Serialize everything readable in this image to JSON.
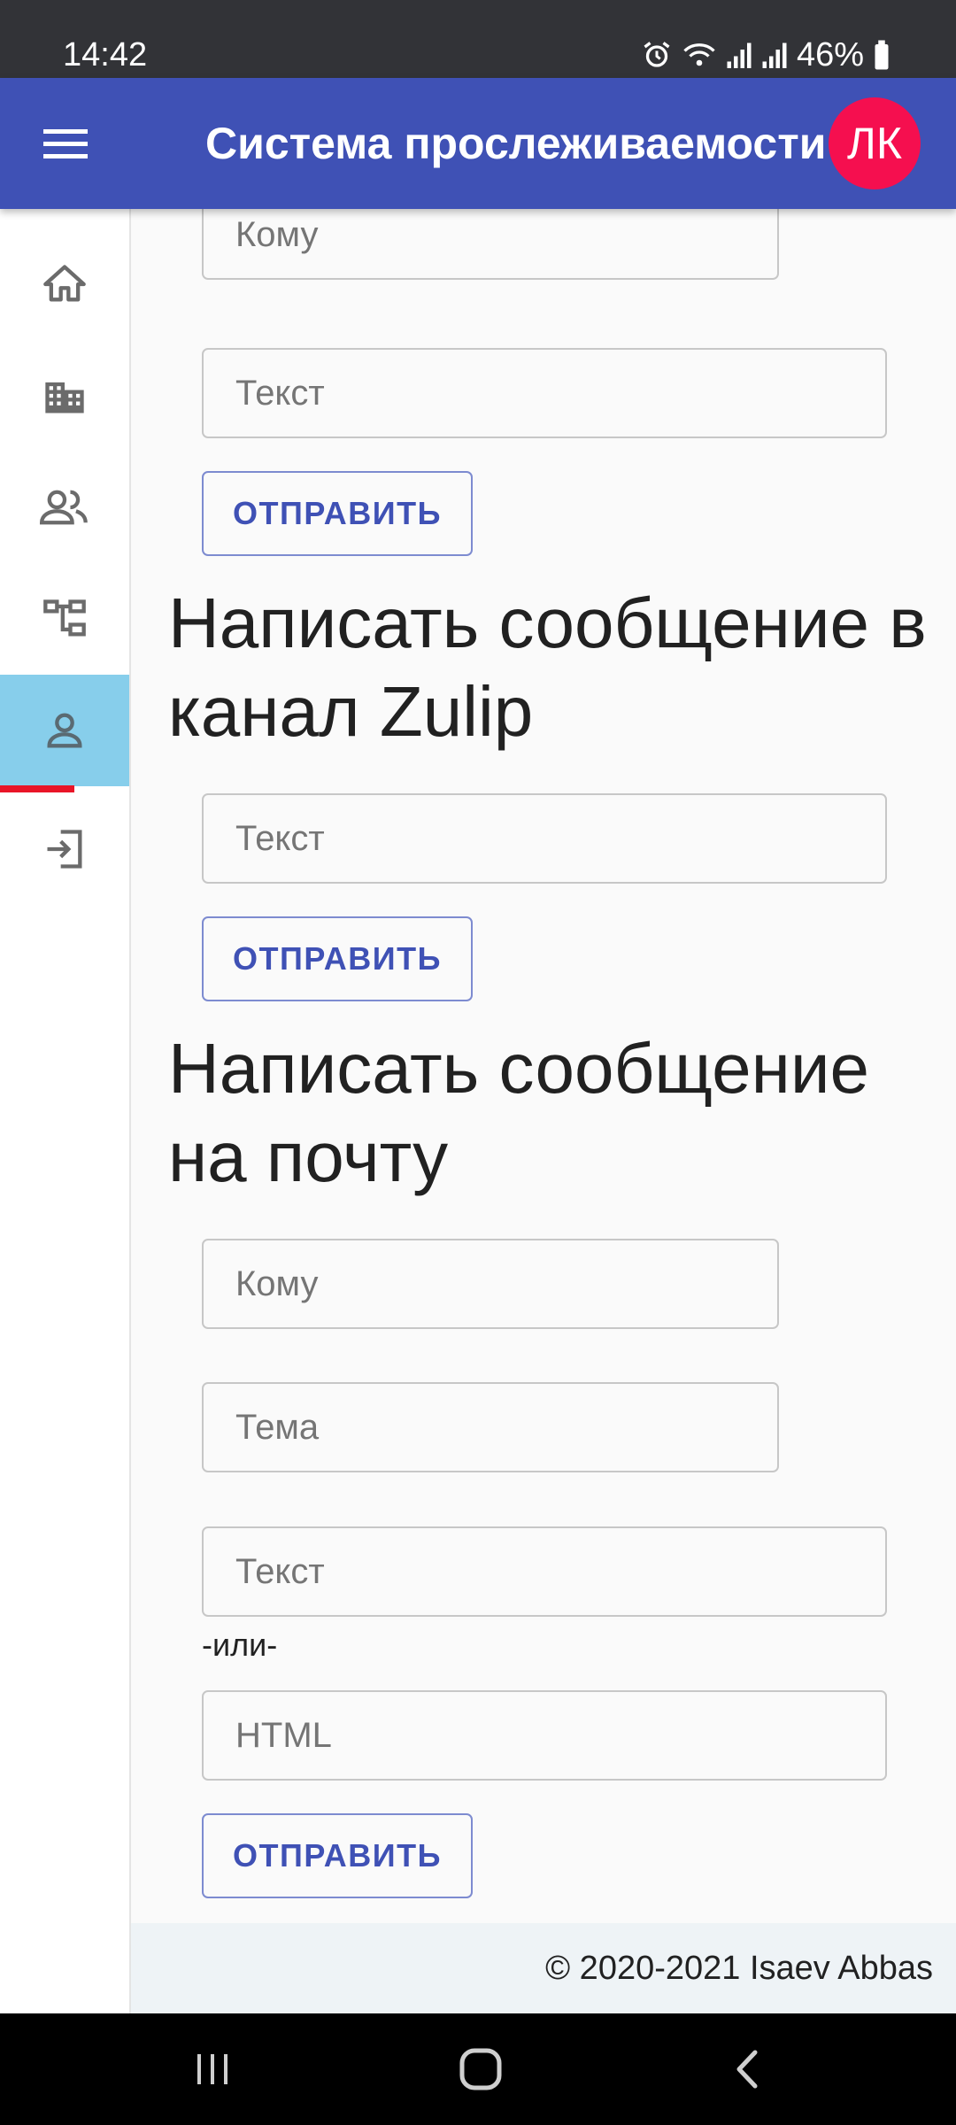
{
  "status_bar": {
    "time": "14:42",
    "battery": "46%",
    "icons": [
      "alarm-icon",
      "wifi-icon",
      "signal-icon",
      "signal-icon",
      "battery-icon"
    ]
  },
  "app_bar": {
    "title": "Система прослеживаемости",
    "profile_label": "ЛК",
    "color": "#3f51b5",
    "profile_color": "#f50f4f"
  },
  "sidebar": {
    "items": [
      {
        "icon": "home-icon",
        "active": false
      },
      {
        "icon": "building-icon",
        "active": false
      },
      {
        "icon": "people-icon",
        "active": false
      },
      {
        "icon": "hierarchy-icon",
        "active": false
      },
      {
        "icon": "person-icon",
        "active": true
      },
      {
        "icon": "logout-icon",
        "active": false
      }
    ],
    "active_color": "#87ceeb",
    "indicator_color": "#e91528"
  },
  "form_top": {
    "to_placeholder": "Кому",
    "text_placeholder": "Текст",
    "send_label": "ОТПРАВИТЬ"
  },
  "zulip_section": {
    "heading": "Написать сообщение в канал Zulip",
    "text_placeholder": "Текст",
    "send_label": "ОТПРАВИТЬ"
  },
  "email_section": {
    "heading": "Написать сообщение на почту",
    "to_placeholder": "Кому",
    "subject_placeholder": "Тема",
    "text_placeholder": "Текст",
    "or_label": "-или-",
    "html_placeholder": "HTML",
    "send_label": "ОТПРАВИТЬ"
  },
  "footer": {
    "text": "© 2020-2021 Isaev Abbas"
  },
  "system_nav": {
    "buttons": [
      "recent-apps-icon",
      "home-circle-icon",
      "back-icon"
    ]
  }
}
